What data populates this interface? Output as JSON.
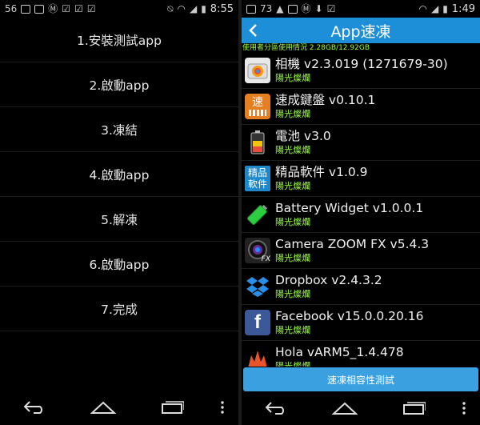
{
  "left": {
    "status": {
      "left_text": "56",
      "time": "8:55"
    },
    "steps": [
      "1.安裝測試app",
      "2.啟動app",
      "3.凍結",
      "4.啟動app",
      "5.解凍",
      "6.啟動app",
      "7.完成"
    ]
  },
  "right": {
    "status": {
      "left_text": "73",
      "time": "1:49"
    },
    "title": "App速凍",
    "storage": "使用者分區使用情況 2.28GB/12.92GB",
    "apps": [
      {
        "name": "相機 v2.3.019 (1271679-30)",
        "developer": "陽光燦爛",
        "icon": "camera-app-icon"
      },
      {
        "name": "速成鍵盤 v0.10.1",
        "developer": "陽光燦爛",
        "icon": "keyboard-app-icon"
      },
      {
        "name": "電池 v3.0",
        "developer": "陽光燦爛",
        "icon": "battery-app-icon"
      },
      {
        "name": "精品軟件 v1.0.9",
        "developer": "陽光燦爛",
        "icon": "software-store-icon"
      },
      {
        "name": "Battery Widget v1.0.0.1",
        "developer": "陽光燦爛",
        "icon": "battery-widget-icon"
      },
      {
        "name": "Camera ZOOM FX v5.4.3",
        "developer": "陽光燦爛",
        "icon": "camera-zoom-fx-icon"
      },
      {
        "name": "Dropbox v2.4.3.2",
        "developer": "陽光燦爛",
        "icon": "dropbox-icon"
      },
      {
        "name": "Facebook v15.0.0.20.16",
        "developer": "陽光燦爛",
        "icon": "facebook-icon"
      },
      {
        "name": "Hola vARM5_1.4.478",
        "developer": "陽光燦爛",
        "icon": "hola-icon"
      }
    ],
    "icon_labels": {
      "keyboard": "速",
      "software_top": "精品",
      "software_bottom": "軟件",
      "camera_fx": "FX"
    },
    "test_button": "速凍相容性測試"
  },
  "colors": {
    "accent": "#1d8fd8",
    "green": "#9cff4a",
    "button": "#3aa0e0"
  }
}
